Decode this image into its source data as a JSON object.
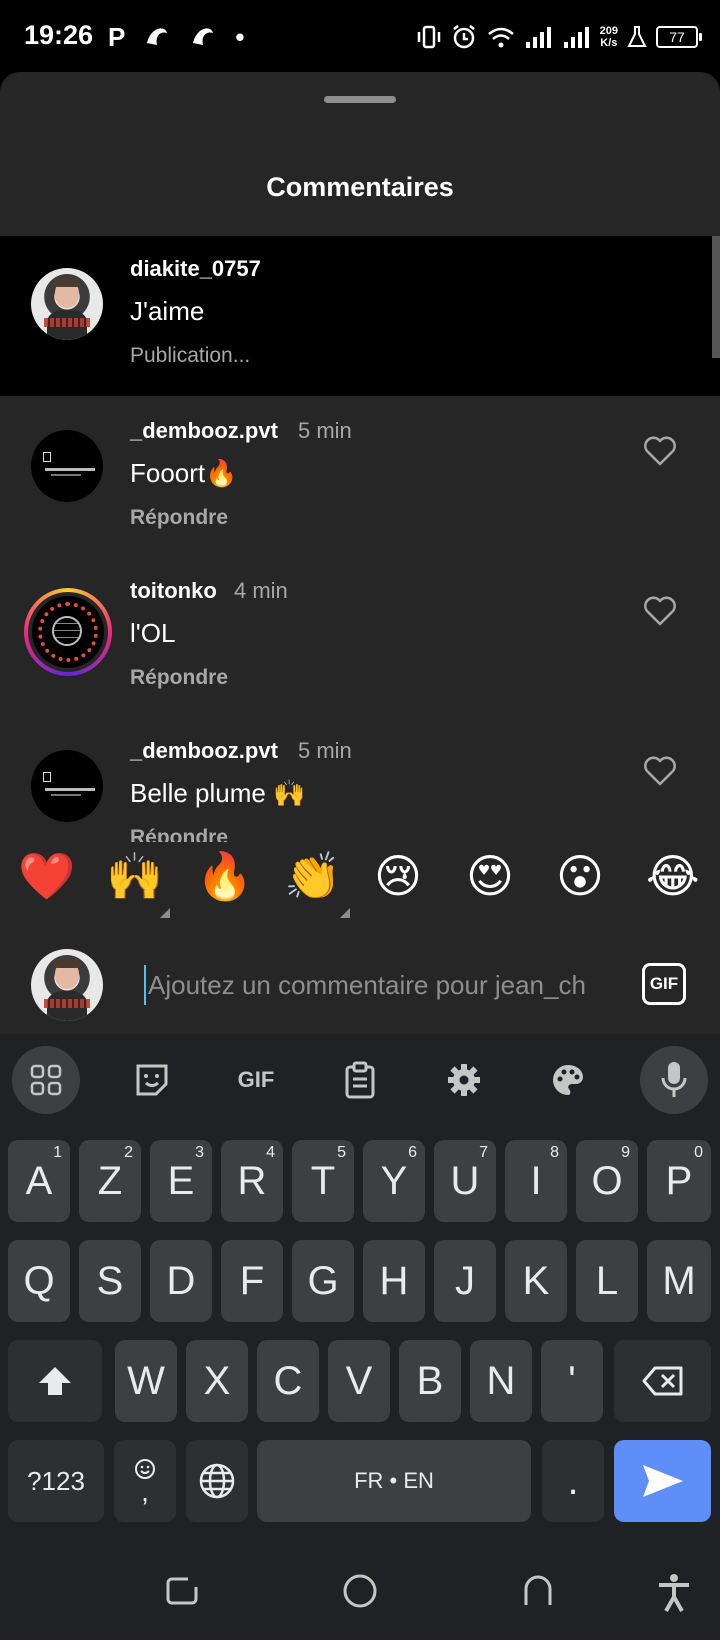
{
  "status_bar": {
    "time": "19:26",
    "left_icons": [
      "P",
      "☇",
      "☇",
      "•"
    ],
    "speed_top": "209",
    "speed_bottom": "K/s",
    "battery": "77"
  },
  "sheet": {
    "title": "Commentaires"
  },
  "caption": {
    "username": "diakite_0757",
    "text": "J'aime",
    "sub": "Publication..."
  },
  "comments": [
    {
      "username": "_dembooz.pvt",
      "time": "5 min",
      "text": "Fooort🔥",
      "reply": "Répondre"
    },
    {
      "username": "toitonko",
      "time": "4 min",
      "text": "l'OL",
      "reply": "Répondre"
    },
    {
      "username": "_dembooz.pvt",
      "time": "5 min",
      "text": "Belle plume 🙌",
      "reply": "Répondre"
    }
  ],
  "emoji_bar": [
    "❤️",
    "🙌",
    "🔥",
    "👏",
    "😢",
    "😍",
    "😮",
    "😂"
  ],
  "input": {
    "placeholder": "Ajoutez un commentaire pour jean_ch",
    "gif_label": "GIF"
  },
  "keyboard": {
    "toolbar_gif": "GIF",
    "row1": [
      {
        "k": "A",
        "n": "1"
      },
      {
        "k": "Z",
        "n": "2"
      },
      {
        "k": "E",
        "n": "3"
      },
      {
        "k": "R",
        "n": "4"
      },
      {
        "k": "T",
        "n": "5"
      },
      {
        "k": "Y",
        "n": "6"
      },
      {
        "k": "U",
        "n": "7"
      },
      {
        "k": "I",
        "n": "8"
      },
      {
        "k": "O",
        "n": "9"
      },
      {
        "k": "P",
        "n": "0"
      }
    ],
    "row2": [
      "Q",
      "S",
      "D",
      "F",
      "G",
      "H",
      "J",
      "K",
      "L",
      "M"
    ],
    "row3": [
      "W",
      "X",
      "C",
      "V",
      "B",
      "N",
      "'"
    ],
    "symbols_key": "?123",
    "comma_key": ",",
    "space_label": "FR • EN",
    "period_key": "."
  }
}
